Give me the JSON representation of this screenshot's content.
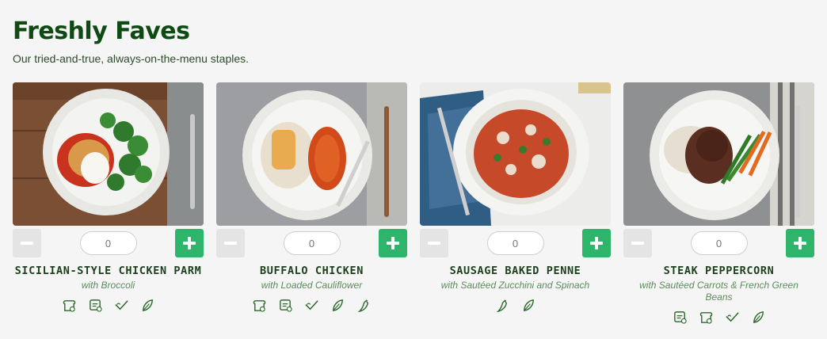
{
  "section": {
    "title": "Freshly Faves",
    "subtitle": "Our tried-and-true, always-on-the-menu staples."
  },
  "colors": {
    "title": "#0f4a14",
    "accent": "#2fb56b",
    "subtitle_text": "#5b8c5b"
  },
  "meals": [
    {
      "name": "SICILIAN-STYLE CHICKEN PARM",
      "side": "with Broccoli",
      "quantity_placeholder": "0",
      "icons": [
        "bread-icon",
        "nutrition-label-icon",
        "checkmark-icon",
        "leaf-icon"
      ]
    },
    {
      "name": "BUFFALO CHICKEN",
      "side": "with Loaded Cauliflower",
      "quantity_placeholder": "0",
      "icons": [
        "bread-icon",
        "nutrition-label-icon",
        "checkmark-icon",
        "leaf-icon",
        "chili-icon"
      ]
    },
    {
      "name": "SAUSAGE BAKED PENNE",
      "side": "with Sautéed Zucchini and Spinach",
      "quantity_placeholder": "0",
      "icons": [
        "chili-icon",
        "leaf-icon"
      ]
    },
    {
      "name": "STEAK PEPPERCORN",
      "side": "with Sautéed Carrots & French Green Beans",
      "quantity_placeholder": "0",
      "icons": [
        "nutrition-label-icon",
        "bread-icon",
        "checkmark-icon",
        "leaf-icon"
      ]
    }
  ]
}
